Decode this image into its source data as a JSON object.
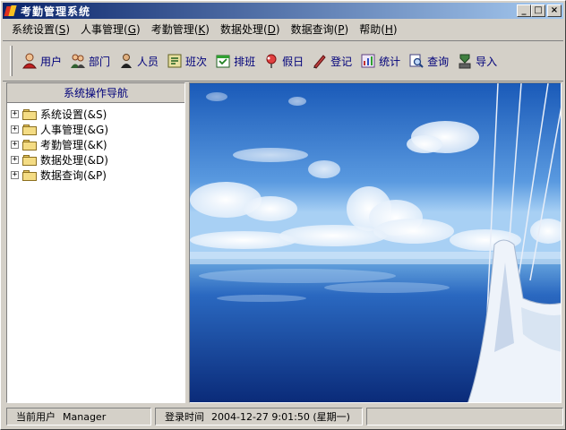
{
  "window": {
    "title": "考勤管理系统",
    "controls": {
      "minimize": "_",
      "maximize": "□",
      "close": "×"
    }
  },
  "menu": [
    {
      "label": "系统设置(",
      "key": "S",
      "suffix": ")"
    },
    {
      "label": "人事管理(",
      "key": "G",
      "suffix": ")"
    },
    {
      "label": "考勤管理(",
      "key": "K",
      "suffix": ")"
    },
    {
      "label": "数据处理(",
      "key": "D",
      "suffix": ")"
    },
    {
      "label": "数据查询(",
      "key": "P",
      "suffix": ")"
    },
    {
      "label": "帮助(",
      "key": "H",
      "suffix": ")"
    }
  ],
  "toolbar": [
    {
      "label": "用户",
      "icon": "user-icon"
    },
    {
      "label": "部门",
      "icon": "department-icon"
    },
    {
      "label": "人员",
      "icon": "staff-icon"
    },
    {
      "label": "班次",
      "icon": "shift-icon"
    },
    {
      "label": "排班",
      "icon": "schedule-icon"
    },
    {
      "label": "假日",
      "icon": "holiday-icon"
    },
    {
      "label": "登记",
      "icon": "register-icon"
    },
    {
      "label": "统计",
      "icon": "statistics-icon"
    },
    {
      "label": "查询",
      "icon": "query-icon"
    },
    {
      "label": "导入",
      "icon": "import-icon"
    }
  ],
  "nav": {
    "header": "系统操作导航",
    "items": [
      {
        "label": "系统设置(&S)",
        "expander": "+"
      },
      {
        "label": "人事管理(&G)",
        "expander": "+"
      },
      {
        "label": "考勤管理(&K)",
        "expander": "+"
      },
      {
        "label": "数据处理(&D)",
        "expander": "+"
      },
      {
        "label": "数据查询(&P)",
        "expander": "+"
      }
    ]
  },
  "status": {
    "user_label": "当前用户",
    "user_value": "Manager",
    "login_label": "登录时间",
    "login_value": "2004-12-27 9:01:50 (星期一)"
  },
  "colors": {
    "title_start": "#0a246a",
    "title_end": "#a6caf0",
    "toolbar_text": "#00007a",
    "sky_top": "#1a5ab8",
    "sea_deep": "#0a2a78"
  }
}
